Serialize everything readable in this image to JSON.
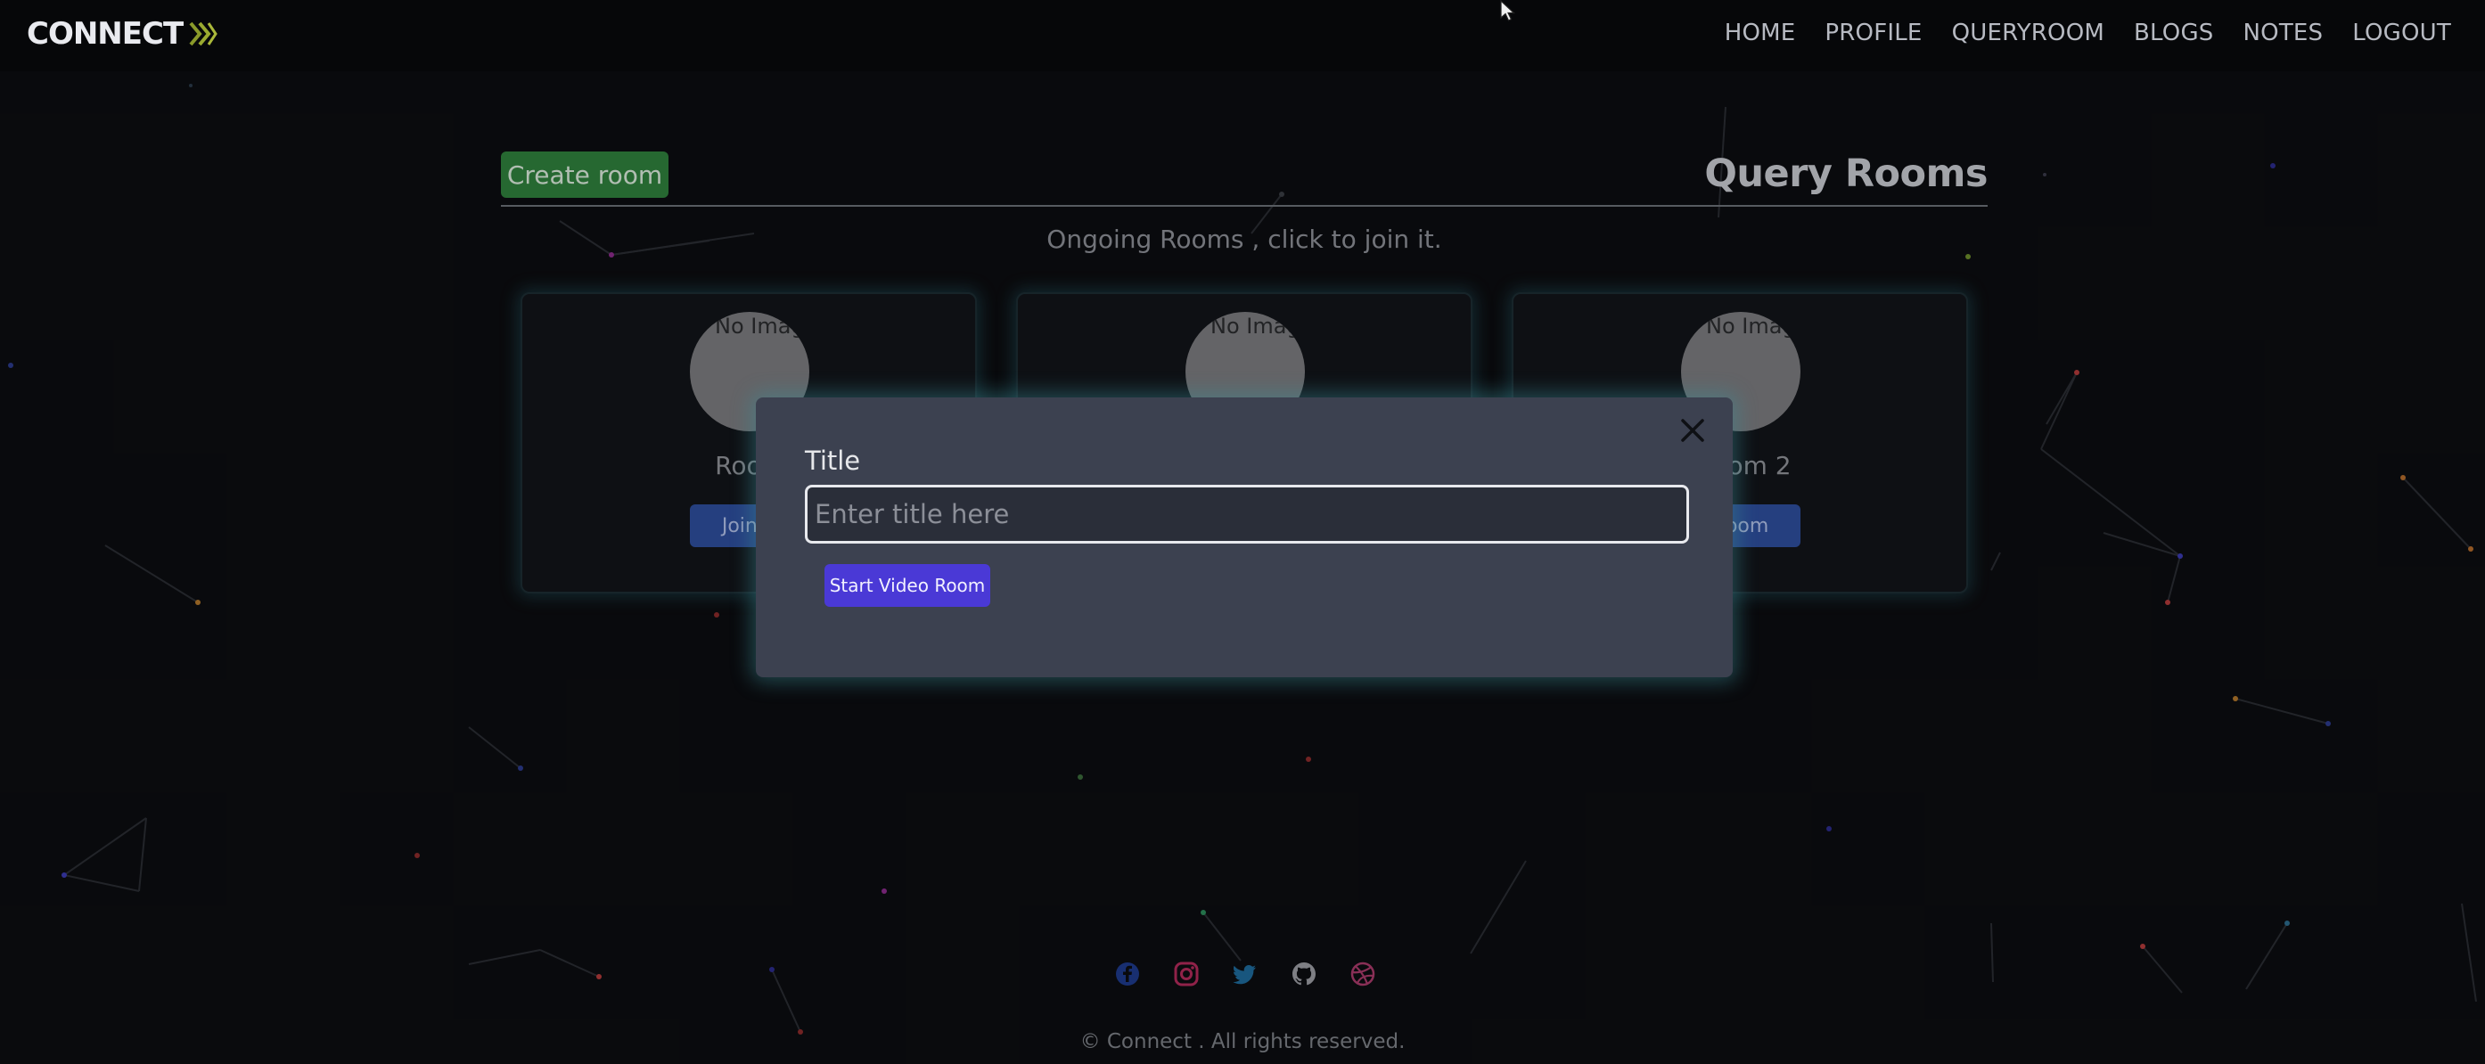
{
  "navbar": {
    "brand": "CONNECT",
    "links": [
      "HOME",
      "PROFILE",
      "QUERYROOM",
      "BLOGS",
      "NOTES",
      "LOGOUT"
    ]
  },
  "main": {
    "create_button": "Create room",
    "title": "Query Rooms",
    "subtitle": "Ongoing Rooms , click to join it.",
    "rooms": [
      {
        "name": "Room",
        "image_alt": "No Image",
        "join_label": "Join R"
      },
      {
        "name": "",
        "image_alt": "No Image",
        "join_label": ""
      },
      {
        "name": "om 2",
        "image_alt": "No Image",
        "join_label": "Room"
      }
    ]
  },
  "modal": {
    "label": "Title",
    "input_value": "",
    "input_placeholder": "Enter title here",
    "submit_label": "Start Video Room"
  },
  "footer": {
    "icons": [
      "facebook-icon",
      "instagram-icon",
      "twitter-icon",
      "github-icon",
      "dribbble-icon"
    ],
    "copyright": "© Connect . All rights reserved."
  },
  "colors": {
    "background": "#0c0d10",
    "navbar": "#060709",
    "create_button": "#2f7f3c",
    "join_button": "#2e4d9c",
    "modal": "#3c4150",
    "start_button": "#4a39d6"
  }
}
